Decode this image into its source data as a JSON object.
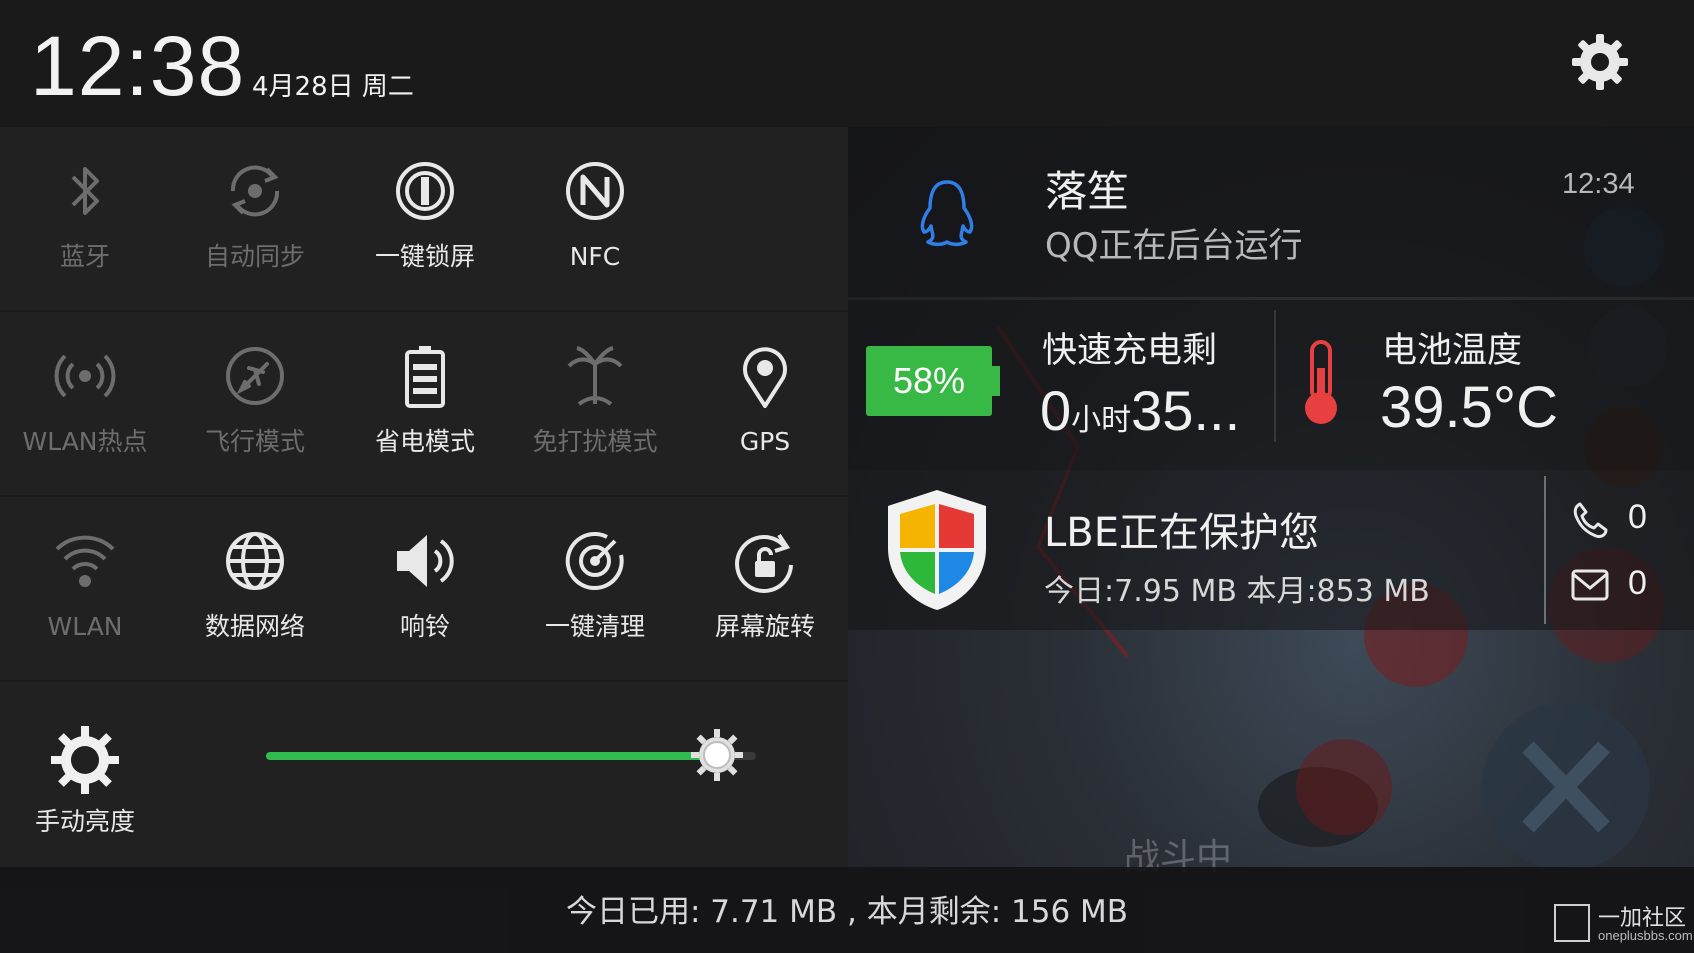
{
  "status": {
    "time": "12:38",
    "date": "4月28日 周二",
    "settings_icon": "gear-icon"
  },
  "toggles": [
    {
      "label": "蓝牙",
      "icon": "bluetooth-icon",
      "active": false
    },
    {
      "label": "自动同步",
      "icon": "sync-icon",
      "active": false
    },
    {
      "label": "一键锁屏",
      "icon": "lock-screen-icon",
      "active": true
    },
    {
      "label": "NFC",
      "icon": "nfc-icon",
      "active": true
    },
    {
      "label": "WLAN热点",
      "icon": "hotspot-icon",
      "active": false
    },
    {
      "label": "飞行模式",
      "icon": "airplane-icon",
      "active": false
    },
    {
      "label": "省电模式",
      "icon": "battery-saver-icon",
      "active": true
    },
    {
      "label": "免打扰模式",
      "icon": "do-not-disturb-icon",
      "active": false
    },
    {
      "label": "GPS",
      "icon": "gps-pin-icon",
      "active": true
    },
    {
      "label": "WLAN",
      "icon": "wifi-icon",
      "active": false
    },
    {
      "label": "数据网络",
      "icon": "globe-icon",
      "active": true
    },
    {
      "label": "响铃",
      "icon": "speaker-icon",
      "active": true
    },
    {
      "label": "一键清理",
      "icon": "clean-icon",
      "active": true
    },
    {
      "label": "屏幕旋转",
      "icon": "rotation-lock-icon",
      "active": true
    }
  ],
  "brightness": {
    "label": "手动亮度",
    "level": 0.92
  },
  "qq": {
    "title": "落笙",
    "subtitle": "QQ正在后台运行",
    "time": "12:34"
  },
  "battery": {
    "percent": "58%",
    "charge_label": "快速充电剩",
    "charge_hours": "0",
    "charge_hours_unit": "小时",
    "charge_minutes": "35...",
    "temp_label": "电池温度",
    "temp_value": "39.5°C",
    "accent": "#38b845"
  },
  "lbe": {
    "title": "LBE正在保护您",
    "subtitle": "今日:7.95 MB 本月:853 MB",
    "calls": "0",
    "sms": "0"
  },
  "background": {
    "overlay_text": "战斗中"
  },
  "footer": {
    "data_usage": "今日已用: 7.71 MB , 本月剩余: 156 MB",
    "watermark_text": "一加社区",
    "watermark_url": "oneplusbbs.com"
  }
}
